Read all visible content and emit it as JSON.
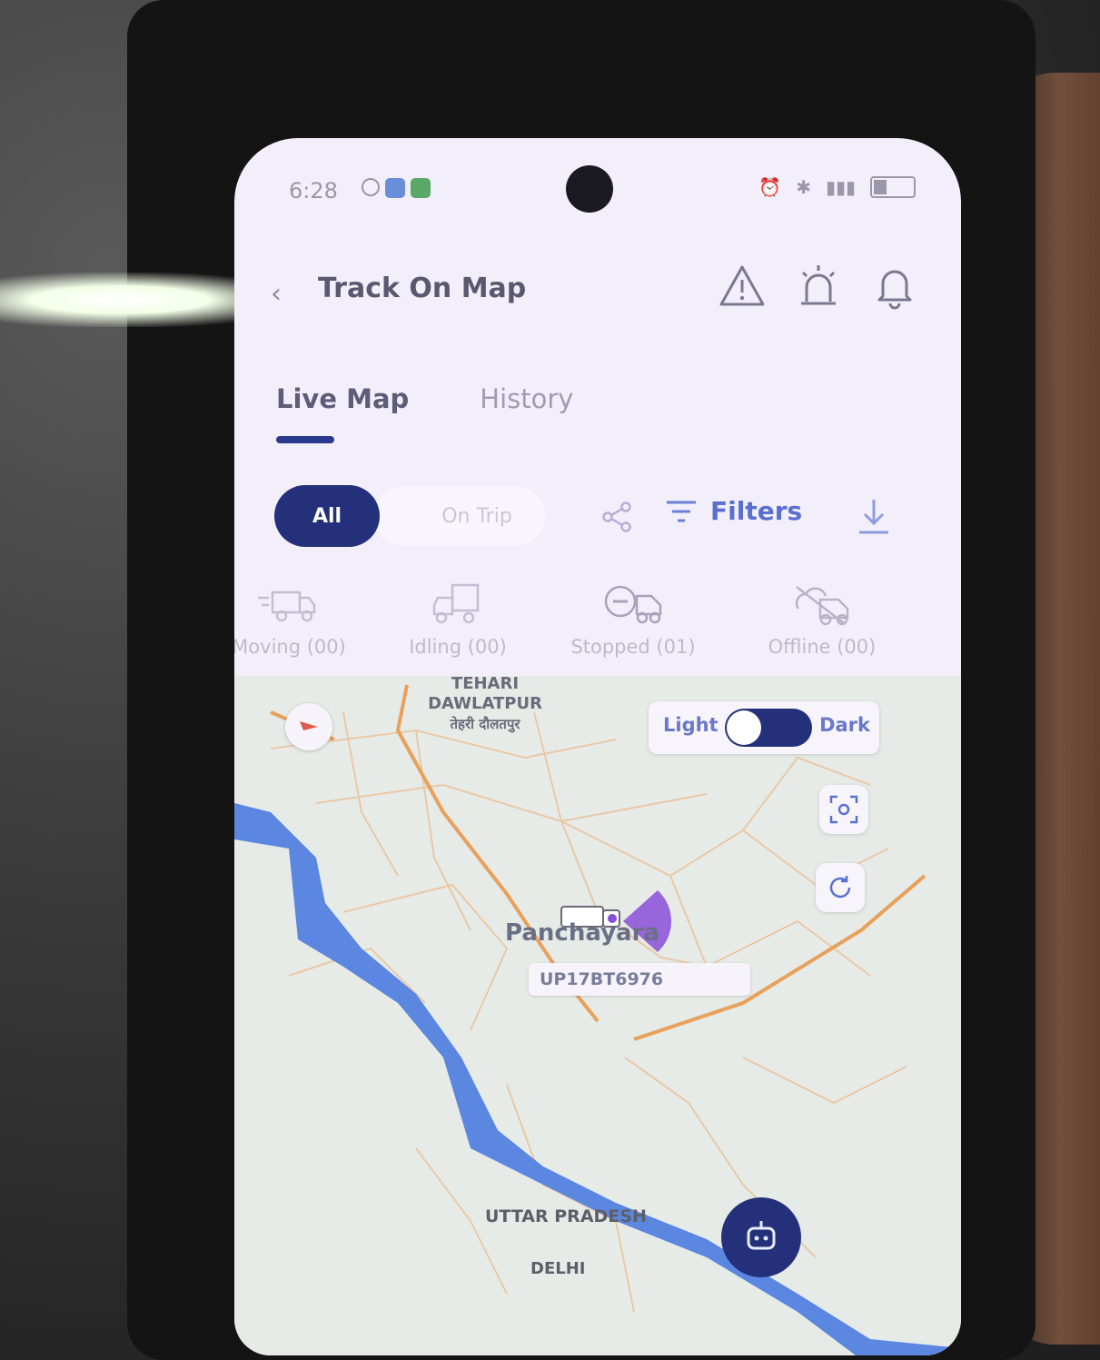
{
  "status_bar": {
    "time": "6:28"
  },
  "header": {
    "back_glyph": "‹",
    "title": "Track On Map"
  },
  "tabs": [
    {
      "label": "Live Map",
      "active": true
    },
    {
      "label": "History",
      "active": false
    }
  ],
  "filter_row": {
    "all_label": "All",
    "on_trip_label": "On Trip",
    "filters_label": "Filters"
  },
  "vehicle_status": [
    {
      "label": "Moving (00)",
      "icon": "truck-moving-icon"
    },
    {
      "label": "Idling (00)",
      "icon": "truck-idling-icon"
    },
    {
      "label": "Stopped (01)",
      "icon": "truck-stopped-icon"
    },
    {
      "label": "Offline (00)",
      "icon": "truck-offline-icon"
    }
  ],
  "map": {
    "theme_toggle": {
      "light_label": "Light",
      "dark_label": "Dark",
      "selected": "Light"
    },
    "labels": {
      "area": "TEHARI DAWLATPUR",
      "area_local": "तेहरी दौलतपुर",
      "village": "Panchayara",
      "state": "UTTAR PRADESH",
      "city": "DELHI"
    },
    "vehicle": {
      "plate": "UP17BT6976"
    },
    "colors": {
      "water": "#5b87e0",
      "major_road": "#e8a05a",
      "minor_road": "#e9c8a6",
      "land": "#e6ebe7",
      "marker": "#8a4fd8"
    }
  },
  "colors": {
    "accent": "#24307a",
    "link": "#5a70d0"
  }
}
